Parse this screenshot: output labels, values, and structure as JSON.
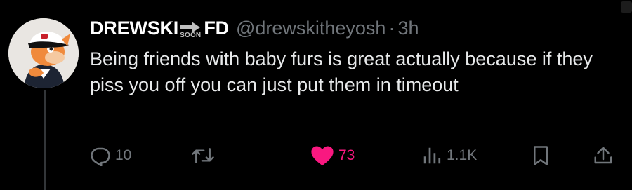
{
  "tweet": {
    "display_name": "DREWSKI",
    "name_suffix": "FD",
    "badge_text": "SOON",
    "handle": "@drewskitheyosh",
    "separator": "·",
    "time": "3h",
    "text": "Being friends with baby furs is great actually because if they piss you off you can just put them in timeout"
  },
  "actions": {
    "reply": {
      "icon": "reply-icon",
      "count": "10"
    },
    "retweet": {
      "icon": "retweet-icon"
    },
    "like": {
      "icon": "heart-icon",
      "count": "73",
      "liked": true,
      "color": "#f91880"
    },
    "views": {
      "icon": "views-icon",
      "count": "1.1K"
    },
    "bookmark": {
      "icon": "bookmark-icon"
    },
    "share": {
      "icon": "share-icon"
    }
  },
  "colors": {
    "background": "#000000",
    "text": "#e7e9ea",
    "secondary": "#71767b",
    "like": "#f91880"
  }
}
